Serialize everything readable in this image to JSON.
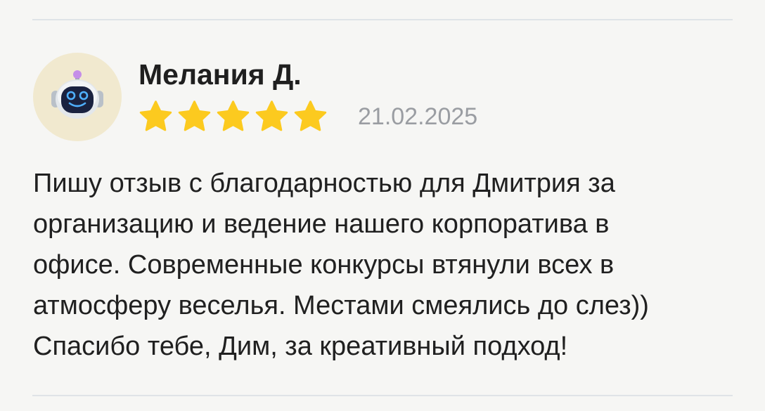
{
  "review": {
    "author_name": "Мелания Д.",
    "avatar_icon": "robot-avatar-icon",
    "rating": 5,
    "rating_max": 5,
    "star_color": "#fcca1f",
    "date": "21.02.2025",
    "text_lines": [
      "Пишу отзыв с благодарностью для Дмитрия за",
      "организацию и ведение нашего корпоратива в",
      "офисе. Современные конкурсы втянули всех в",
      "атмосферу веселья. Местами смеялись до слез))",
      "Спасибо тебе, Дим, за креативный подход!"
    ]
  }
}
